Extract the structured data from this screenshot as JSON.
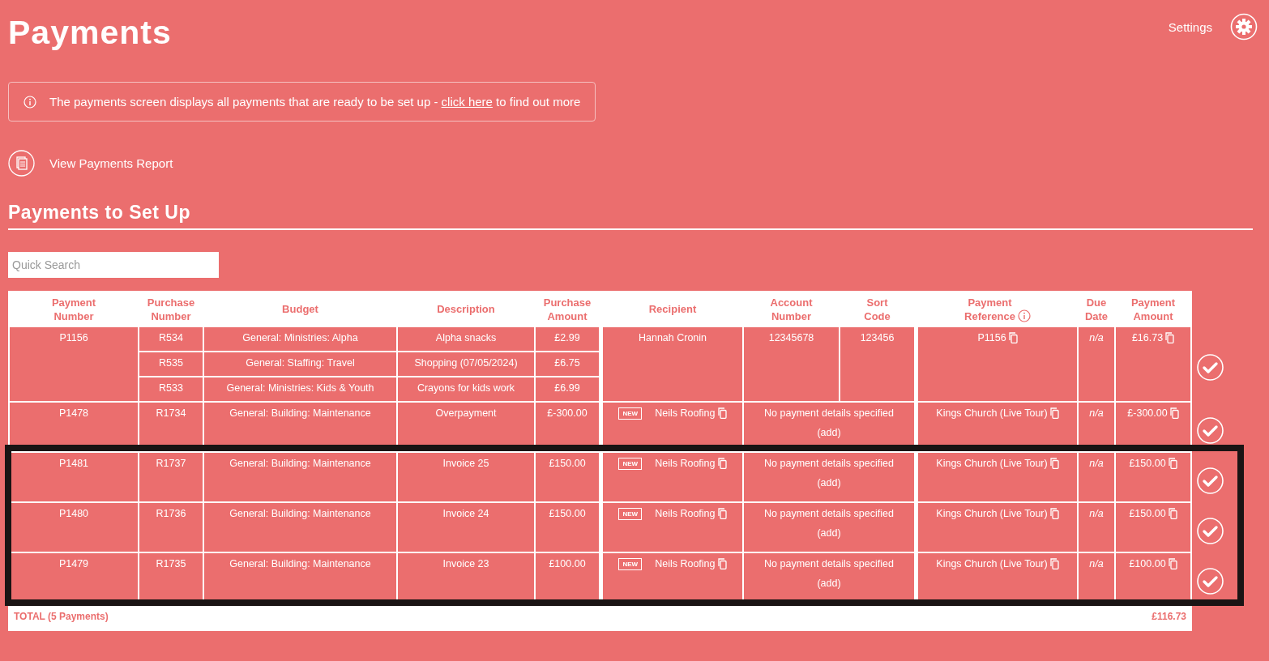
{
  "page": {
    "title": "Payments",
    "settings_label": "Settings"
  },
  "info_banner": {
    "text_before": "The payments screen displays all payments that are ready to be set up - ",
    "link": "click here",
    "text_after": " to find out more"
  },
  "report_link": "View Payments Report",
  "section_title": "Payments to Set Up",
  "search": {
    "placeholder": "Quick Search"
  },
  "table": {
    "columns": [
      {
        "label": "Payment Number",
        "has_info": false
      },
      {
        "label": "Purchase Number",
        "has_info": false
      },
      {
        "label": "Budget",
        "has_info": false
      },
      {
        "label": "Description",
        "has_info": false
      },
      {
        "label": "Purchase Amount",
        "has_info": false
      },
      {
        "label": "Recipient",
        "has_info": false
      },
      {
        "label": "Account Number",
        "has_info": false
      },
      {
        "label": "Sort Code",
        "has_info": false
      },
      {
        "label": "Payment Reference",
        "has_info": true
      },
      {
        "label": "Due Date",
        "has_info": false
      },
      {
        "label": "Payment Amount",
        "has_info": false
      }
    ],
    "payments": [
      {
        "number": "P1156",
        "lines": [
          {
            "purchase_number": "R534",
            "budget": "General: Ministries: Alpha",
            "description": "Alpha snacks",
            "amount": "£2.99"
          },
          {
            "purchase_number": "R535",
            "budget": "General: Staffing: Travel",
            "description": "Shopping (07/05/2024)",
            "amount": "£6.75"
          },
          {
            "purchase_number": "R533",
            "budget": "General: Ministries: Kids & Youth",
            "description": "Crayons for kids work",
            "amount": "£6.99"
          }
        ],
        "recipient": "Hannah Cronin",
        "recipient_copyable": false,
        "kind": "bank",
        "account_number": "12345678",
        "sort_code": "123456",
        "reference": "P1156",
        "due_date": "n/a",
        "payment_amount": "£16.73",
        "outlined": false
      },
      {
        "number": "P1478",
        "lines": [
          {
            "purchase_number": "R1734",
            "budget": "General: Building: Maintenance",
            "description": "Overpayment",
            "amount": "£-300.00"
          }
        ],
        "badge": "NEW",
        "recipient": "Neils Roofing",
        "recipient_copyable": true,
        "kind": "missing",
        "details": "No payment details specified",
        "details_action": "(add)",
        "reference": "Kings Church (Live Tour)",
        "due_date": "n/a",
        "payment_amount": "£-300.00",
        "outlined": false
      },
      {
        "number": "P1481",
        "lines": [
          {
            "purchase_number": "R1737",
            "budget": "General: Building: Maintenance",
            "description": "Invoice 25",
            "amount": "£150.00"
          }
        ],
        "badge": "NEW",
        "recipient": "Neils Roofing",
        "recipient_copyable": true,
        "kind": "missing",
        "details": "No payment details specified",
        "details_action": "(add)",
        "reference": "Kings Church (Live Tour)",
        "due_date": "n/a",
        "payment_amount": "£150.00",
        "outlined": true
      },
      {
        "number": "P1480",
        "lines": [
          {
            "purchase_number": "R1736",
            "budget": "General: Building: Maintenance",
            "description": "Invoice 24",
            "amount": "£150.00"
          }
        ],
        "badge": "NEW",
        "recipient": "Neils Roofing",
        "recipient_copyable": true,
        "kind": "missing",
        "details": "No payment details specified",
        "details_action": "(add)",
        "reference": "Kings Church (Live Tour)",
        "due_date": "n/a",
        "payment_amount": "£150.00",
        "outlined": true
      },
      {
        "number": "P1479",
        "lines": [
          {
            "purchase_number": "R1735",
            "budget": "General: Building: Maintenance",
            "description": "Invoice 23",
            "amount": "£100.00"
          }
        ],
        "badge": "NEW",
        "recipient": "Neils Roofing",
        "recipient_copyable": true,
        "kind": "missing",
        "details": "No payment details specified",
        "details_action": "(add)",
        "reference": "Kings Church (Live Tour)",
        "due_date": "n/a",
        "payment_amount": "£100.00",
        "outlined": true
      }
    ],
    "total": {
      "label": "TOTAL (5 Payments)",
      "amount": "£116.73"
    }
  }
}
